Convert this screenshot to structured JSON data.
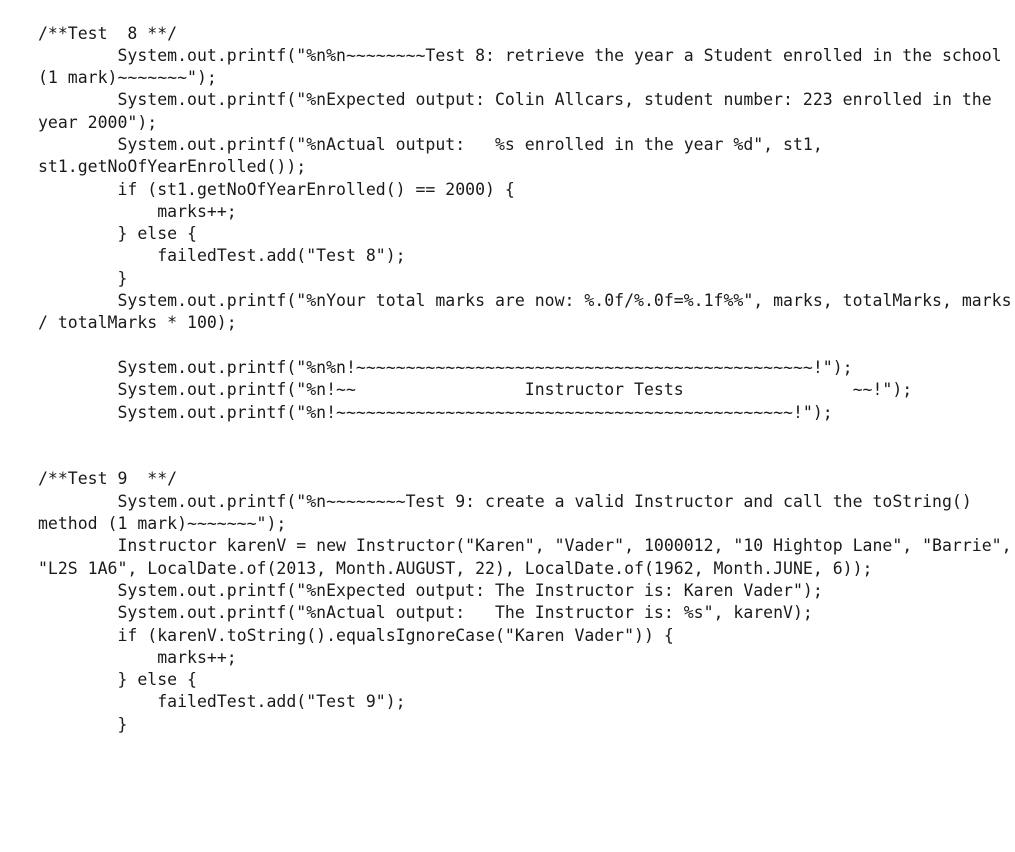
{
  "document": {
    "type": "java-source-code-listing",
    "language": "Java",
    "background_color": "#ffffff",
    "text_color": "#1a1a1a",
    "lines": [
      "/**Test  8 **/",
      "        System.out.printf(\"%n%n~~~~~~~~Test 8: retrieve the year a Student enrolled in the school (1 mark)~~~~~~~\");",
      "        System.out.printf(\"%nExpected output: Colin Allcars, student number: 223 enrolled in the year 2000\");",
      "        System.out.printf(\"%nActual output:   %s enrolled in the year %d\", st1, st1.getNoOfYearEnrolled());",
      "        if (st1.getNoOfYearEnrolled() == 2000) {",
      "            marks++;",
      "        } else {",
      "            failedTest.add(\"Test 8\");",
      "        }",
      "        System.out.printf(\"%nYour total marks are now: %.0f/%.0f=%.1f%%\", marks, totalMarks, marks / totalMarks * 100);",
      "",
      "        System.out.printf(\"%n%n!~~~~~~~~~~~~~~~~~~~~~~~~~~~~~~~~~~~~~~~~~~~~~~!\");",
      "        System.out.printf(\"%n!~~                 Instructor Tests                 ~~!\");",
      "        System.out.printf(\"%n!~~~~~~~~~~~~~~~~~~~~~~~~~~~~~~~~~~~~~~~~~~~~~~!\");",
      "",
      "",
      "/**Test 9  **/",
      "        System.out.printf(\"%n~~~~~~~~Test 9: create a valid Instructor and call the toString() method (1 mark)~~~~~~~\");",
      "        Instructor karenV = new Instructor(\"Karen\", \"Vader\", 1000012, \"10 Hightop Lane\", \"Barrie\", \"L2S 1A6\", LocalDate.of(2013, Month.AUGUST, 22), LocalDate.of(1962, Month.JUNE, 6));",
      "        System.out.printf(\"%nExpected output: The Instructor is: Karen Vader\");",
      "        System.out.printf(\"%nActual output:   The Instructor is: %s\", karenV);",
      "        if (karenV.toString().equalsIgnoreCase(\"Karen Vader\")) {",
      "            marks++;",
      "        } else {",
      "            failedTest.add(\"Test 9\");",
      "        }"
    ]
  }
}
